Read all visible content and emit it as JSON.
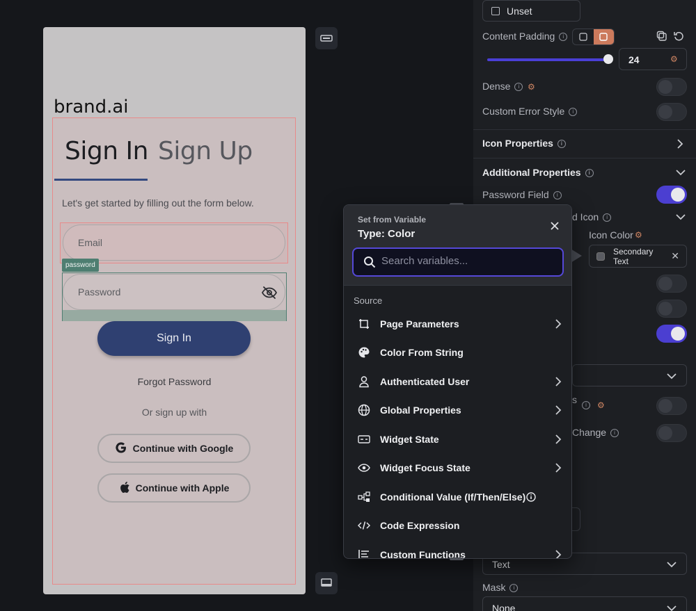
{
  "canvas": {
    "brand": "brand.ai",
    "tab_signin": "Sign In",
    "tab_signup": "Sign Up",
    "subtitle": "Let's get started by filling out the form below.",
    "email_placeholder": "Email",
    "password_tag": "password",
    "password_placeholder": "Password",
    "signin_button": "Sign In",
    "forgot_password": "Forgot Password",
    "or_sign_up": "Or sign up with",
    "google_button": "Continue with Google",
    "apple_button": "Continue with Apple"
  },
  "panel": {
    "unset_label": "Unset",
    "content_padding_label": "Content Padding",
    "padding_value": "24",
    "dense_label": "Dense",
    "custom_error_label": "Custom Error Style",
    "icon_properties_label": "Icon Properties",
    "additional_properties_label": "Additional Properties",
    "password_field_label": "Password Field",
    "partial_icon_label": "d Icon",
    "icon_color_label": "Icon Color",
    "icon_color_value": "Secondary Text",
    "partial_s_label": "s",
    "partial_change_label": "Change",
    "keyboard_type_value": "Text",
    "mask_label": "Mask",
    "mask_value": "None",
    "toggles": {
      "password_field": true,
      "dense": false,
      "custom_error": false,
      "t1": false,
      "t2": false,
      "t3": true,
      "t4": false,
      "t5": false
    }
  },
  "popup": {
    "kicker": "Set from Variable",
    "title": "Type: Color",
    "search_placeholder": "Search variables...",
    "source_label": "Source",
    "options": [
      {
        "label": "Page Parameters",
        "icon": "page-parameters-icon",
        "chevron": true
      },
      {
        "label": "Color From String",
        "icon": "palette-icon",
        "chevron": false
      },
      {
        "label": "Authenticated User",
        "icon": "user-icon",
        "chevron": true
      },
      {
        "label": "Global Properties",
        "icon": "globe-icon",
        "chevron": true
      },
      {
        "label": "Widget State",
        "icon": "widget-state-icon",
        "chevron": true
      },
      {
        "label": "Widget Focus State",
        "icon": "eye-icon",
        "chevron": true
      },
      {
        "label": "Conditional Value (If/Then/Else)",
        "icon": "conditional-icon",
        "chevron": false,
        "info": true
      },
      {
        "label": "Code Expression",
        "icon": "code-icon",
        "chevron": false
      },
      {
        "label": "Custom Functions",
        "icon": "functions-icon",
        "chevron": true
      }
    ]
  },
  "colors": {
    "accent": "#4b3fd1",
    "primary_button": "#2f4071",
    "selection_outline": "#e88a8a",
    "warm_accent": "#cc7a5c"
  }
}
